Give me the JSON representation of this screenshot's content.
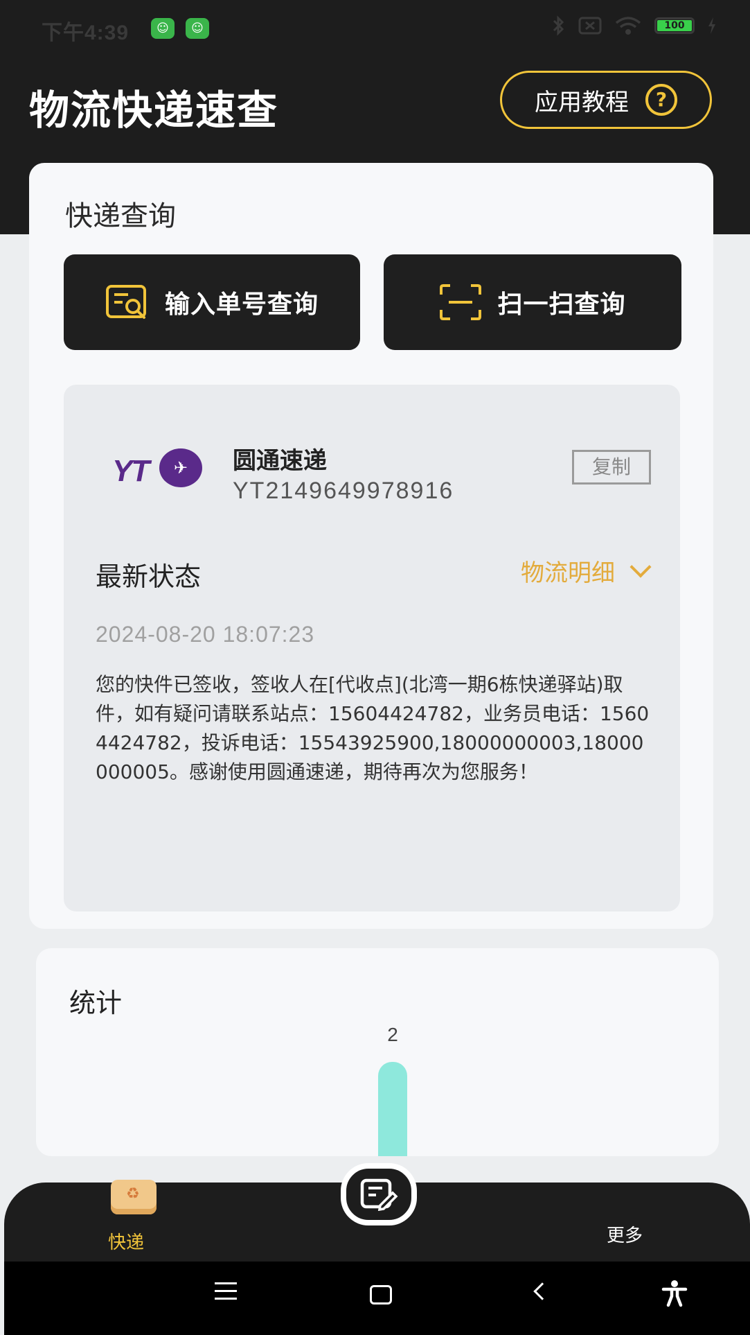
{
  "status_bar": {
    "time": "下午4:39",
    "battery": "100"
  },
  "header": {
    "title": "物流快递速查",
    "tutorial_label": "应用教程",
    "help_glyph": "?"
  },
  "query_card": {
    "title": "快递查询",
    "manual_button": "输入单号查询",
    "scan_button": "扫一扫查询"
  },
  "result": {
    "carrier_logo": "YT",
    "carrier_name": "圆通速递",
    "tracking_number": "YT2149649978916",
    "copy_label": "复制",
    "latest_label": "最新状态",
    "detail_link": "物流明细",
    "timestamp": "2024-08-20 18:07:23",
    "description": "您的快件已签收，签收人在[代收点](北湾一期6栋快递驿站)取件，如有疑问请联系站点：15604424782，业务员电话：15604424782，投诉电话：15543925900,18000000003,18000000005。感谢使用圆通速递，期待再次为您服务！"
  },
  "stats": {
    "title": "统计",
    "chart_data": {
      "type": "bar",
      "values": [
        2
      ],
      "bar_color": "#8ee8dc"
    }
  },
  "tab_bar": {
    "express_label": "快递",
    "more_label": "更多"
  },
  "colors": {
    "accent": "#f1c43a",
    "dark": "#1d1d1d",
    "detail_link": "#e3ab3c"
  }
}
